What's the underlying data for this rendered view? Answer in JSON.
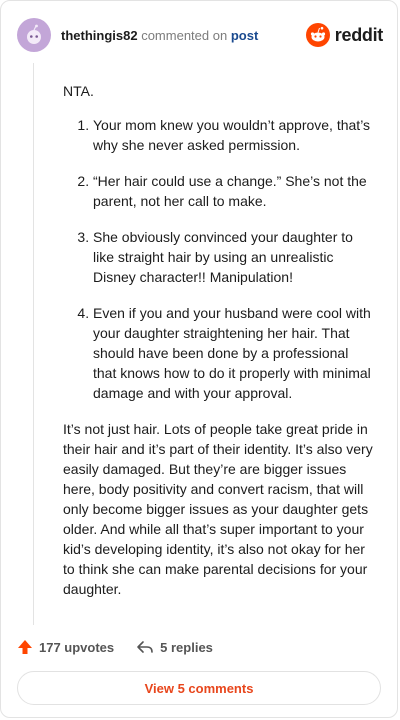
{
  "header": {
    "username": "thethingis82",
    "action_text": "commented on",
    "post_link": "post",
    "brand": "reddit"
  },
  "comment": {
    "intro": "NTA.",
    "points": [
      "Your mom knew you wouldn’t approve, that’s why she never asked permission.",
      "“Her hair could use a change.” She’s not the parent, not her call to make.",
      "She obviously convinced your daughter to like straight hair by using an unrealistic Disney character!! Manipulation!",
      "Even if you and your husband were cool with your daughter straightening her hair. That should have been done by a professional that knows how to do it properly with minimal damage and with your approval."
    ],
    "closing": "It’s not just hair. Lots of people take great pride in their hair and it’s part of their identity. It’s also very easily damaged. But they’re are bigger issues here, body positivity and convert racism, that will only become bigger issues as your daughter gets older. And while all that’s super important to your kid’s developing identity, it’s also not okay for her to think she can make parental decisions for your daughter."
  },
  "footer": {
    "upvotes": "177 upvotes",
    "replies": "5 replies",
    "view_comments": "View 5 comments"
  },
  "colors": {
    "accent": "#ff4500",
    "link": "#1a4a8f",
    "upvote": "#ff4500",
    "avatar_bg": "#c3a6d8"
  },
  "icons": {
    "avatar": "snoo-avatar-icon",
    "brand": "reddit-logo-icon",
    "upvote": "upvote-arrow-icon",
    "reply": "reply-arrow-icon"
  }
}
